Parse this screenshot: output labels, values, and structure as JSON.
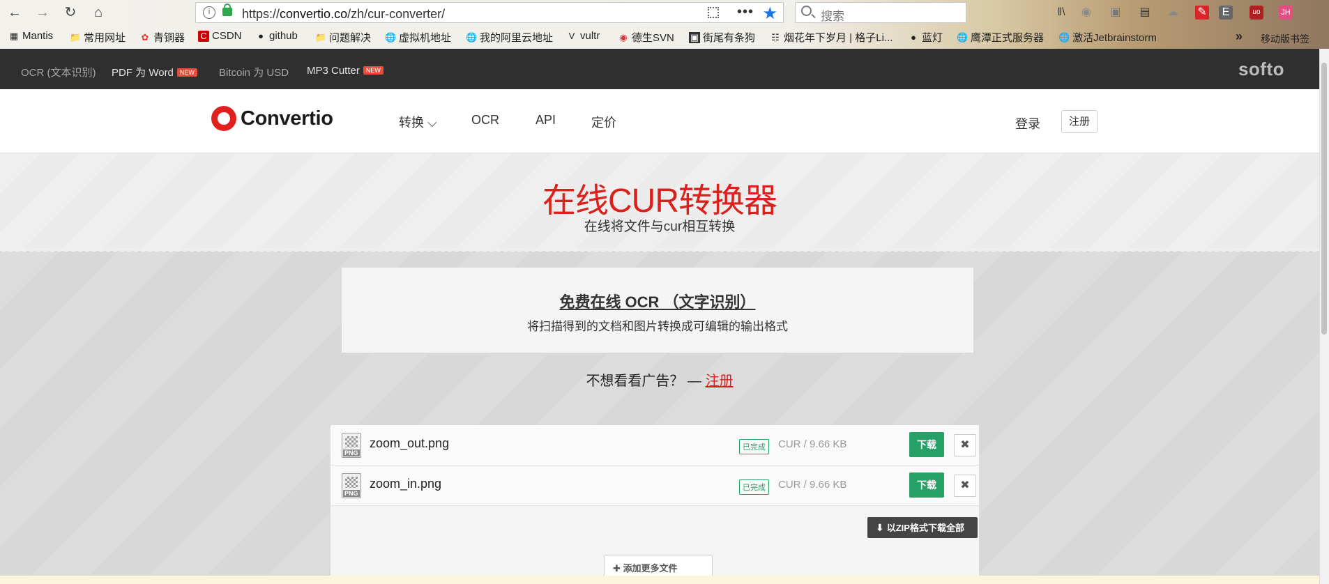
{
  "browser": {
    "url_prefix": "https://",
    "url_host": "convertio.co",
    "url_path": "/zh/cur-converter/",
    "search_placeholder": "搜索",
    "overflow_label": "»",
    "mobile_bookmarks": "移动版书签",
    "bookmarks": [
      {
        "label": "Mantis",
        "icon": "mantis-icon"
      },
      {
        "label": "常用网址",
        "icon": "folder-icon"
      },
      {
        "label": "青铜器",
        "icon": "bronze-icon"
      },
      {
        "label": "CSDN",
        "icon": "csdn-icon"
      },
      {
        "label": "github",
        "icon": "github-icon"
      },
      {
        "label": "问题解决",
        "icon": "folder-icon"
      },
      {
        "label": "虚拟机地址",
        "icon": "globe-icon"
      },
      {
        "label": "我的阿里云地址",
        "icon": "globe-icon"
      },
      {
        "label": "vultr",
        "icon": "vultr-icon"
      },
      {
        "label": "德生SVN",
        "icon": "chrome-icon"
      },
      {
        "label": "街尾有条狗",
        "icon": "image-icon"
      },
      {
        "label": "烟花年下岁月 | 格子Li...",
        "icon": "site-icon"
      },
      {
        "label": "蓝灯",
        "icon": "github-icon"
      },
      {
        "label": "鹰潭正式服务器",
        "icon": "globe-icon"
      },
      {
        "label": "激活Jetbrainstorm",
        "icon": "globe-icon"
      }
    ]
  },
  "softo_bar": {
    "links": [
      {
        "label": "OCR (文本识别)",
        "badge": ""
      },
      {
        "label": "PDF 为 Word",
        "badge": "NEW"
      },
      {
        "label": "Bitcoin 为 USD",
        "badge": ""
      },
      {
        "label": "MP3 Cutter",
        "badge": "NEW"
      }
    ],
    "logo": "softo"
  },
  "header": {
    "logo_text": "Convertio",
    "menu": [
      {
        "label": "转换 ⌵"
      },
      {
        "label": "OCR"
      },
      {
        "label": "API"
      },
      {
        "label": "定价"
      }
    ],
    "login": "登录",
    "signup": "注册"
  },
  "hero": {
    "title": "在线CUR转换器",
    "subtitle": "在线将文件与cur相互转换"
  },
  "promo": {
    "title": "免费在线 OCR （文字识别）",
    "description": "将扫描得到的文档和图片转换成可编辑的输出格式"
  },
  "no_ads": {
    "text": "不想看看广告？ — ",
    "link": "注册"
  },
  "files": [
    {
      "name": "zoom_out.png",
      "type": "PNG",
      "status": "已完成",
      "size": "CUR / 9.66 KB",
      "download": "下载",
      "remove": "✖"
    },
    {
      "name": "zoom_in.png",
      "type": "PNG",
      "status": "已完成",
      "size": "CUR / 9.66 KB",
      "download": "下载",
      "remove": "✖"
    }
  ],
  "zip_download": "以ZIP格式下载全部",
  "add_more": "添加更多文件",
  "colors": {
    "brand_red": "#d9221c",
    "success_green": "#27a066",
    "dark_bar": "#2f2f2f"
  }
}
